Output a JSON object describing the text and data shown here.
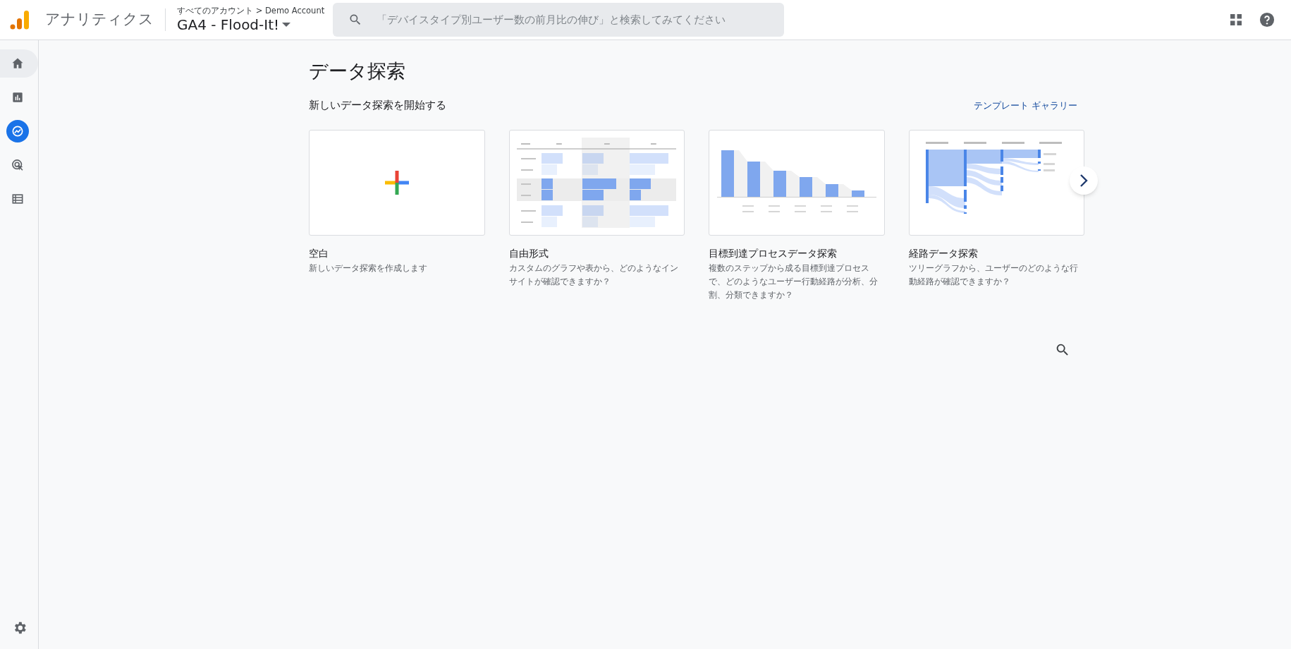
{
  "header": {
    "app_name": "アナリティクス",
    "breadcrumb": "すべてのアカウント > Demo Account",
    "property": "GA4 - Flood-It!",
    "search": {
      "placeholder": "「デバイスタイプ別ユーザー数の前月比の伸び」と検索してみてください"
    }
  },
  "sidebar": {
    "items": [
      {
        "kind": "home",
        "selected": false,
        "hovered": true
      },
      {
        "kind": "reports",
        "selected": false,
        "hovered": false
      },
      {
        "kind": "explore",
        "selected": true,
        "hovered": false
      },
      {
        "kind": "advertising",
        "selected": false,
        "hovered": false
      },
      {
        "kind": "configure",
        "selected": false,
        "hovered": false
      }
    ]
  },
  "page": {
    "title": "データ探索",
    "section_title": "新しいデータ探索を開始する",
    "gallery_link": "テンプレート ギャラリー",
    "templates": [
      {
        "kind": "blank",
        "title": "空白",
        "description": "新しいデータ探索を作成します"
      },
      {
        "kind": "freeform",
        "title": "自由形式",
        "description": "カスタムのグラフや表から、どのようなインサイトが確認できますか？"
      },
      {
        "kind": "funnel",
        "title": "目標到達プロセスデータ探索",
        "description": "複数のステップから成る目標到達プロセスで、どのようなユーザー行動経路が分析、分割、分類できますか？"
      },
      {
        "kind": "path",
        "title": "経路データ探索",
        "description": "ツリーグラフから、ユーザーのどのような行動経路が確認できますか？"
      }
    ]
  }
}
